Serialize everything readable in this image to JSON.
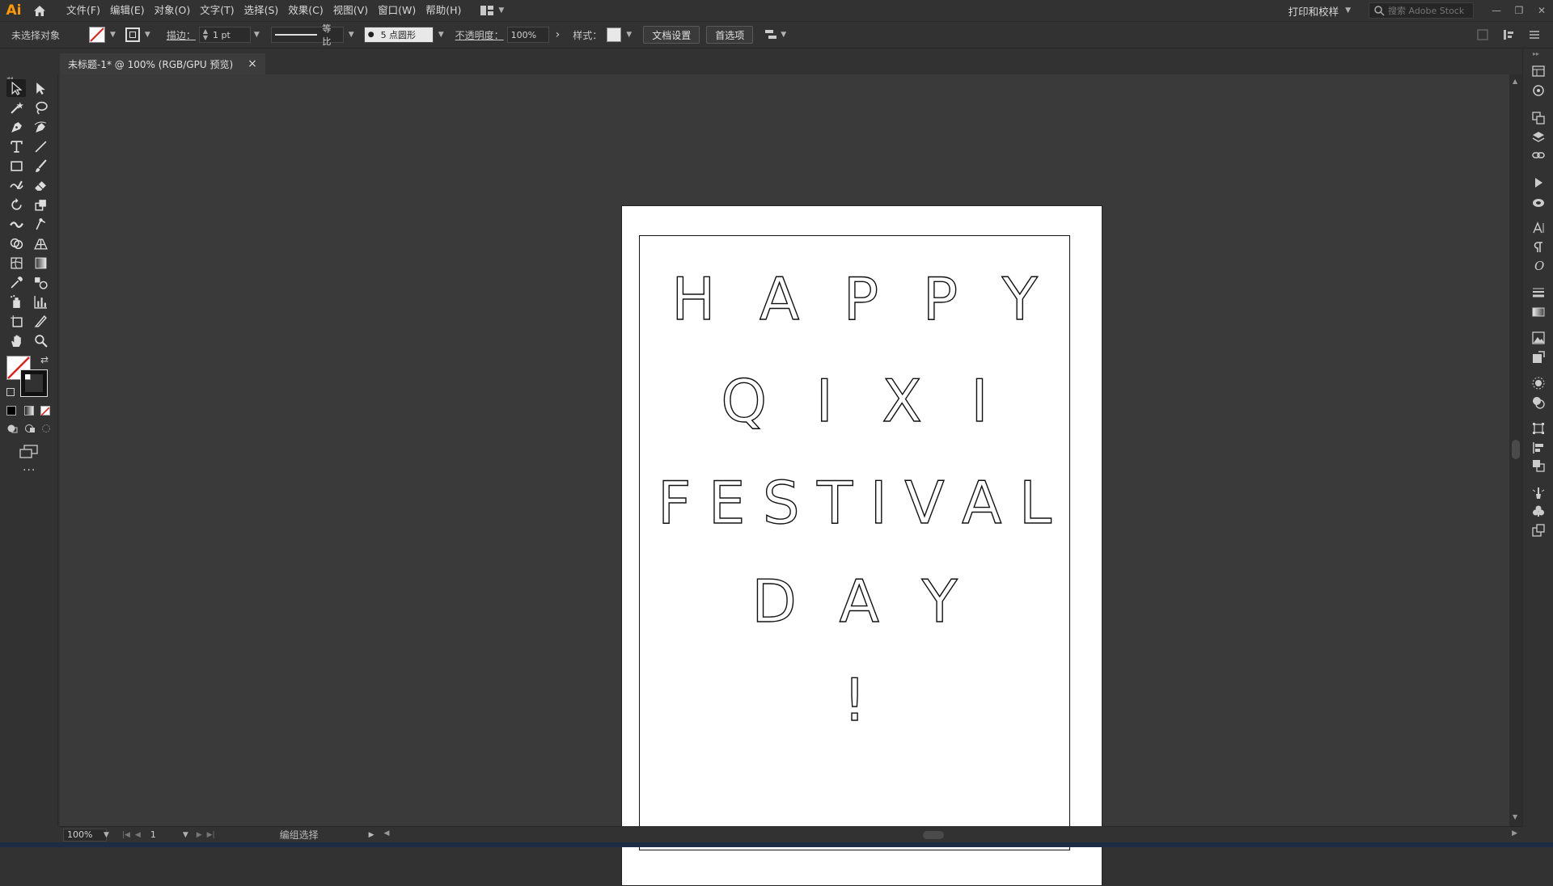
{
  "app": {
    "logo": "Ai"
  },
  "menu": {
    "items": [
      "文件(F)",
      "编辑(E)",
      "对象(O)",
      "文字(T)",
      "选择(S)",
      "效果(C)",
      "视图(V)",
      "窗口(W)",
      "帮助(H)"
    ],
    "workspace": "打印和校样",
    "stock_search_placeholder": "搜索 Adobe Stock"
  },
  "control": {
    "selection_status": "未选择对象",
    "stroke_label": "描边：",
    "stroke_weight": "1 pt",
    "stroke_profile": "等比",
    "brush": "5 点圆形",
    "opacity_label": "不透明度：",
    "opacity_value": "100%",
    "style_label": "样式：",
    "doc_setup_button": "文档设置",
    "preferences_button": "首选项"
  },
  "document": {
    "tab_title": "未标题-1* @ 100% (RGB/GPU 预览)",
    "close_glyph": "×"
  },
  "artwork": {
    "lines": [
      [
        "H",
        "A",
        "P",
        "P",
        "Y"
      ],
      [
        "Q",
        "I",
        "X",
        "I"
      ],
      [
        "F",
        "E",
        "S",
        "T",
        "I",
        "V",
        "A",
        "L"
      ],
      [
        "D",
        "A",
        "Y"
      ],
      [
        "!"
      ]
    ]
  },
  "status": {
    "zoom": "100%",
    "artboard_number": "1",
    "tool_status": "编组选择"
  },
  "colors": {
    "accent_logo": "#ff9a00",
    "ui_background": "#323232",
    "canvas": "#3a3a3a",
    "artboard": "#ffffff"
  }
}
